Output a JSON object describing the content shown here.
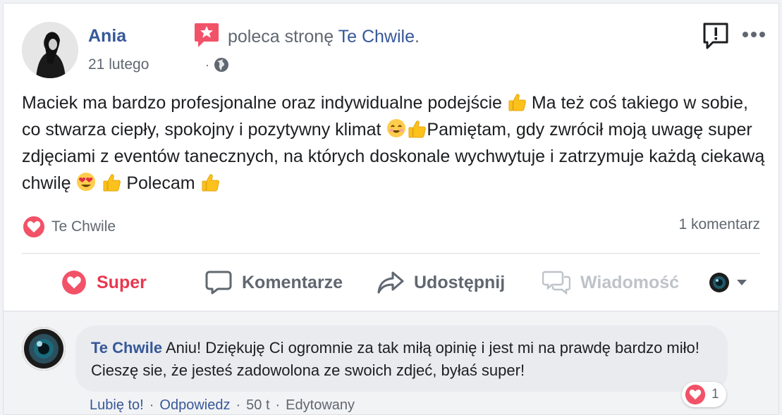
{
  "post": {
    "author": "Ania",
    "date": "21 lutego",
    "date_sep": "·",
    "recommend_prefix": "poleca stronę",
    "page_name": "Te Chwile",
    "recommend_suffix": ".",
    "text_parts": [
      "Maciek ma bardzo profesjonalne oraz indywidualne podejście ",
      " Ma też coś takiego w sobie, co stwarza ciepły, spokojny i pozytywny klimat ",
      "Pamiętam, gdy zwrócił moją uwagę super zdjęciami z eventów tanecznych, na których doskonale wychwytuje i zatrzymuje każdą ciekawą chwilę ",
      " Polecam "
    ]
  },
  "reactions": {
    "name": "Te Chwile",
    "comments_count": "1 komentarz"
  },
  "actions": {
    "super": "Super",
    "comment": "Komentarze",
    "share": "Udostępnij",
    "message": "Wiadomość"
  },
  "comment": {
    "author": "Te Chwile",
    "text": "Aniu! Dziękuję Ci ogromnie za tak miłą opinię i jest mi na prawdę bardzo miło! Cieszę sie, że jesteś zadowolona ze swoich zdjeć, byłaś super!",
    "reaction_count": "1",
    "like": "Lubię to!",
    "reply": "Odpowiedz",
    "time": "50 t",
    "edited": "Edytowany",
    "sep": "·"
  },
  "colors": {
    "link": "#365899",
    "super": "#e8384f",
    "muted": "#606770"
  },
  "icons": [
    "recommend-icon",
    "report-icon",
    "more-icon",
    "globe-icon",
    "love-icon",
    "comment-icon",
    "share-icon",
    "message-icon",
    "chevron-down-icon",
    "thumbs-up-emoji",
    "smile-emoji",
    "heart-eyes-emoji"
  ]
}
